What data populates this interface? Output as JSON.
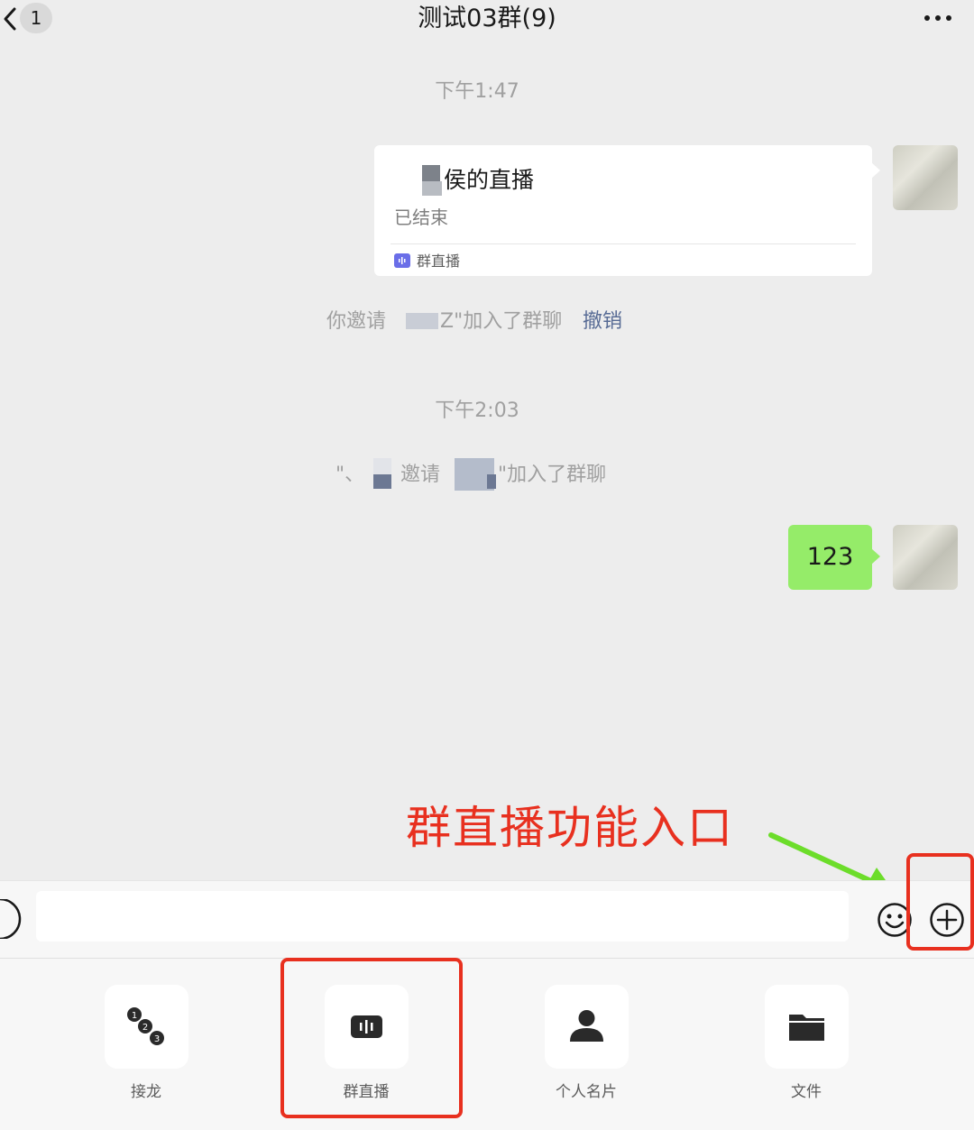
{
  "header": {
    "back_icon": "chevron-left-icon",
    "unread_count": "1",
    "title": "测试03群(9)",
    "more_icon": "more-icon"
  },
  "chat": {
    "time1": "下午1:47",
    "live_card": {
      "title": "侯的直播",
      "status": "已结束",
      "app_label": "群直播",
      "app_icon": "live-wave-icon"
    },
    "system_msg1": {
      "prefix": "你邀请",
      "name_fragment": "Z",
      "suffix": "\"加入了群聊",
      "revoke_label": "撤销"
    },
    "time2": "下午2:03",
    "system_msg2": {
      "quote_fragment": "\"、",
      "middle": "邀请",
      "suffix": "\"加入了群聊"
    },
    "text_message": "123"
  },
  "annotation": {
    "text": "群直播功能入口",
    "color": "#e8301f",
    "arrow_color": "#6cdd2a"
  },
  "input_bar": {
    "voice_icon": "voice-icon",
    "emoji_icon": "emoji-icon",
    "plus_icon": "plus-icon",
    "input_value": ""
  },
  "toolbar": [
    {
      "label": "接龙",
      "icon": "numbered-chain-icon"
    },
    {
      "label": "群直播",
      "icon": "live-wave-icon"
    },
    {
      "label": "个人名片",
      "icon": "person-icon"
    },
    {
      "label": "文件",
      "icon": "folder-icon"
    }
  ],
  "colors": {
    "background": "#ededed",
    "bubble_green": "#95ec69",
    "link_blue": "#576b95",
    "live_purple": "#6a6ee8"
  }
}
